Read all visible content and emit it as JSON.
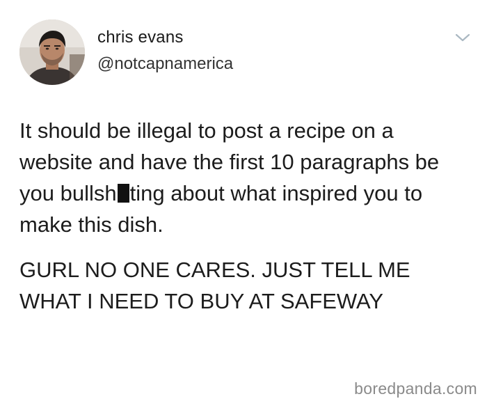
{
  "tweet": {
    "user": {
      "name": "chris evans",
      "handle": "@notcapnamerica",
      "avatar_icon": "profile-photo"
    },
    "menu_icon": "chevron-down-icon",
    "text": {
      "line1_before_redaction": "It should be illegal to post a recipe on a website and have the first 10 paragraphs be you bullsh",
      "line1_after_redaction": "ting about what inspired you to make this dish.",
      "line2": "GURL NO ONE CARES.  JUST TELL ME WHAT I NEED TO BUY AT SAFEWAY"
    }
  },
  "watermark": "boredpanda.com",
  "colors": {
    "background": "#ffffff",
    "text": "#1c1c1c",
    "watermark": "#8a8a8a",
    "caret": "#aab8c2"
  }
}
